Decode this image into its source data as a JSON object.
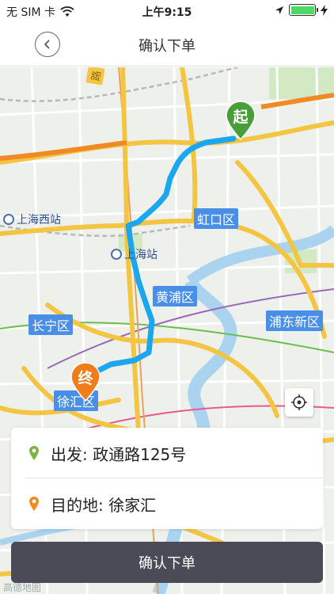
{
  "status_bar": {
    "carrier": "无 SIM 卡",
    "wifi_icon": "wifi-icon",
    "time": "上午9:15",
    "location_icon": "location-arrow-icon",
    "battery_icon": "battery-icon",
    "battery_percent": 100,
    "charging_icon": "charging-bolt-icon"
  },
  "nav": {
    "back_icon": "chevron-left-icon",
    "title": "确认下单"
  },
  "map": {
    "districts": {
      "hongkou": "虹口区",
      "huangpu": "黄浦区",
      "changning": "长宁区",
      "pudong": "浦东新区",
      "xuhui": "徐汇区"
    },
    "pois": {
      "shanghai_west_station": "上海西站",
      "shanghai_station": "上海站"
    },
    "road_label": "路",
    "start_marker": "起",
    "end_marker": "终",
    "logo": "高德地图",
    "colors": {
      "route": "#1aa7f0",
      "start_marker": "#4a9e3a",
      "end_marker": "#f07c1a",
      "district_label": "#4a8fe7",
      "river": "#a9d3ef",
      "major_road": "#f4c542"
    }
  },
  "address": {
    "origin_icon": "green-pin-icon",
    "origin": "出发: 政通路125号",
    "destination_icon": "orange-pin-icon",
    "destination": "目的地: 徐家汇"
  },
  "locate_icon": "crosshair-locate-icon",
  "confirm_button": "确认下单"
}
